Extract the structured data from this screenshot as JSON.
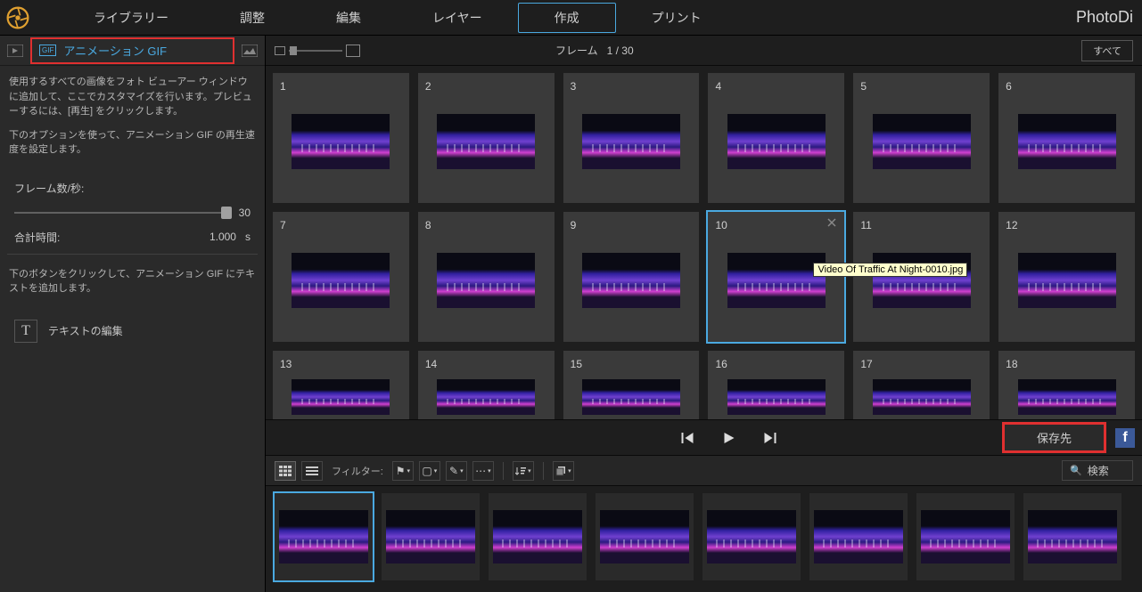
{
  "app": {
    "name": "PhotoDi"
  },
  "tabs": {
    "library": "ライブラリー",
    "adjust": "調整",
    "edit": "編集",
    "layer": "レイヤー",
    "create": "作成",
    "print": "プリント"
  },
  "sidebar": {
    "gif_button": "アニメーション GIF",
    "desc1": "使用するすべての画像をフォト ビューアー ウィンドウに追加して、ここでカスタマイズを行います。プレビューするには、[再生] をクリックします。",
    "desc2": "下のオプションを使って、アニメーション GIF の再生速度を設定します。",
    "fps_label": "フレーム数/秒:",
    "fps_value": "30",
    "total_time_label": "合計時間:",
    "total_time_value": "1.000",
    "total_time_unit": "s",
    "desc3": "下のボタンをクリックして、アニメーション GIF にテキストを追加します。",
    "text_edit": "テキストの編集"
  },
  "frame_header": {
    "label": "フレーム",
    "counter": "1 / 30",
    "all_button": "すべて"
  },
  "frames": [
    {
      "n": "1"
    },
    {
      "n": "2"
    },
    {
      "n": "3"
    },
    {
      "n": "4"
    },
    {
      "n": "5"
    },
    {
      "n": "6"
    },
    {
      "n": "7"
    },
    {
      "n": "8"
    },
    {
      "n": "9"
    },
    {
      "n": "10",
      "selected": true
    },
    {
      "n": "11"
    },
    {
      "n": "12"
    },
    {
      "n": "13"
    },
    {
      "n": "14"
    },
    {
      "n": "15"
    },
    {
      "n": "16"
    },
    {
      "n": "17"
    },
    {
      "n": "18"
    }
  ],
  "tooltip": "Video Of Traffic At Night-0010.jpg",
  "playback": {
    "save_button": "保存先"
  },
  "toolbar": {
    "filter_label": "フィルター:",
    "search_label": "検索"
  }
}
